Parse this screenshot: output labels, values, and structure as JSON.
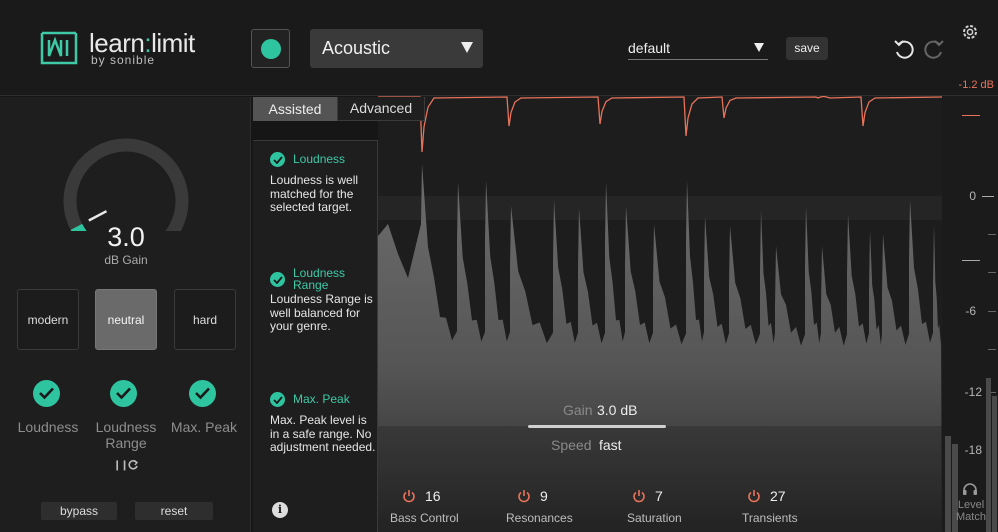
{
  "app": {
    "logo_word_a": "learn",
    "logo_colon": ":",
    "logo_word_b": "limit",
    "logo_by": "by sonible"
  },
  "header": {
    "genre": "Acoustic",
    "preset": "default",
    "save_label": "save",
    "peak_readout": "-1.2 dB"
  },
  "left": {
    "gain_value": "3.0",
    "gain_unit": "dB Gain",
    "gain_level": 0.08,
    "modes": [
      {
        "label": "modern",
        "active": false
      },
      {
        "label": "neutral",
        "active": true
      },
      {
        "label": "hard",
        "active": false
      }
    ],
    "checks": [
      {
        "label": "Loudness"
      },
      {
        "label": "Loudness Range"
      },
      {
        "label": "Max. Peak"
      }
    ],
    "bypass_label": "bypass",
    "reset_label": "reset"
  },
  "tabs": {
    "assisted": "Assisted",
    "advanced": "Advanced",
    "active": "assisted"
  },
  "assistant": {
    "items": [
      {
        "title": "Loudness",
        "text": "Loudness is well matched for the selected target."
      },
      {
        "title": "Loudness Range",
        "text": "Loudness Range is well balanced for your genre."
      },
      {
        "title": "Max. Peak",
        "text": "Max. Peak level is in a safe range. No adjustment needed."
      }
    ]
  },
  "controls": {
    "gain_label": "Gain",
    "gain_value": "3.0 dB",
    "speed_label": "Speed",
    "speed_value": "fast"
  },
  "modules": [
    {
      "name": "Bass Control",
      "value": "16"
    },
    {
      "name": "Resonances",
      "value": "9"
    },
    {
      "name": "Saturation",
      "value": "7"
    },
    {
      "name": "Transients",
      "value": "27"
    }
  ],
  "meter": {
    "ticks": [
      "0",
      "-6",
      "-12",
      "-18"
    ],
    "level_match_label": "Level Match"
  },
  "colors": {
    "accent": "#2ec4a0",
    "peak": "#e8735a"
  }
}
